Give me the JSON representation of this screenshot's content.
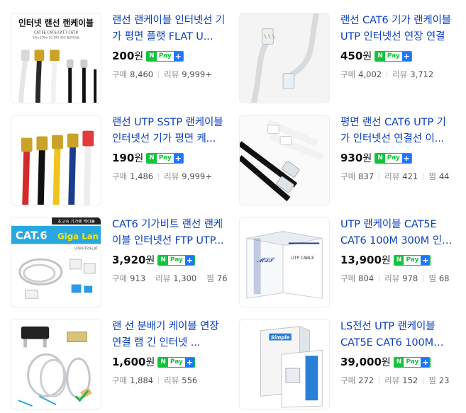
{
  "products": [
    {
      "title": "랜선 랜케이블 인터넷선 기가 평면 플랫 FLAT U...",
      "price": "200",
      "currency": "원",
      "npay": {
        "n": "N",
        "pay": "Pay",
        "plus": "+"
      },
      "meta": [
        {
          "label": "구매",
          "value": "8,460"
        },
        {
          "label": "리뷰",
          "value": "9,999+"
        }
      ],
      "thumb_text": {
        "heading": "인터넷 랜선 랜케이블",
        "sub": "CAT.5E CAT.6 CAT.7 CAT.8",
        "sub2": "10m 100m 1G 10G 40G 평면케이블"
      }
    },
    {
      "title": "랜선 CAT6 기가 랜케이블 UTP 인터넷선 연장 연결",
      "price": "450",
      "currency": "원",
      "npay": {
        "n": "N",
        "pay": "Pay",
        "plus": "+"
      },
      "meta": [
        {
          "label": "구매",
          "value": "4,002"
        },
        {
          "label": "리뷰",
          "value": "3,712"
        }
      ]
    },
    {
      "title": "랜선 UTP SSTP 랜케이블 인터넷선 기가 평면 케...",
      "price": "190",
      "currency": "원",
      "npay": {
        "n": "N",
        "pay": "Pay",
        "plus": "+"
      },
      "meta": [
        {
          "label": "구매",
          "value": "1,486"
        },
        {
          "label": "리뷰",
          "value": "9,999+"
        }
      ]
    },
    {
      "title": "평면 랜선 CAT6 UTP 기가 인터넷선 연결선 이...",
      "price": "930",
      "currency": "원",
      "npay": {
        "n": "N",
        "pay": "Pay",
        "plus": "+"
      },
      "meta": [
        {
          "label": "구매",
          "value": "837"
        },
        {
          "label": "리뷰",
          "value": "421"
        },
        {
          "label": "찜",
          "value": "44"
        }
      ]
    },
    {
      "title": "CAT6 기가비트 랜선 랜케이블 인터넷선 FTP UTP...",
      "price": "3,920",
      "currency": "원",
      "npay": {
        "n": "N",
        "pay": "Pay",
        "plus": "+"
      },
      "meta": [
        {
          "label": "구매",
          "value": "913"
        },
        {
          "label": "리뷰",
          "value": "1,300"
        },
        {
          "label": "찜",
          "value": "76"
        }
      ],
      "thumb_text": {
        "heading": "CAT.6",
        "heading2": "Giga Lan",
        "banner": "초고속 기가랜 케이블",
        "sub": "UTP/FTP/FLAT"
      }
    },
    {
      "title": "UTP 랜케이블 CAT5E CAT6 100M 300M 인터넷...",
      "price": "13,900",
      "currency": "원",
      "npay": {
        "n": "N",
        "pay": "Pay",
        "plus": "+"
      },
      "meta": [
        {
          "label": "구매",
          "value": "804"
        },
        {
          "label": "리뷰",
          "value": "978"
        },
        {
          "label": "찜",
          "value": "68"
        }
      ],
      "thumb_text": {
        "box": "UTP CABLE"
      }
    },
    {
      "title": "랜 선 분배기 케이블 연장 연결 램 긴 인터넷 ...",
      "price": "1,600",
      "currency": "원",
      "npay": {
        "n": "N",
        "pay": "Pay",
        "plus": "+"
      },
      "meta": [
        {
          "label": "구매",
          "value": "1,884"
        },
        {
          "label": "리뷰",
          "value": "556"
        }
      ]
    },
    {
      "title": "LS전선 UTP 랜케이블 CAT5E CAT6 100M 300M ...",
      "price": "39,000",
      "currency": "원",
      "npay": {
        "n": "N",
        "pay": "Pay",
        "plus": "+"
      },
      "meta": [
        {
          "label": "구매",
          "value": "272"
        },
        {
          "label": "리뷰",
          "value": "152"
        },
        {
          "label": "찜",
          "value": "23"
        }
      ],
      "thumb_text": {
        "box": "Simple"
      }
    }
  ],
  "colors": {
    "title": "#0a3fbf",
    "npay_green": "#13c33b",
    "npay_blue": "#1e78ff",
    "meta": "#8a8f96"
  }
}
